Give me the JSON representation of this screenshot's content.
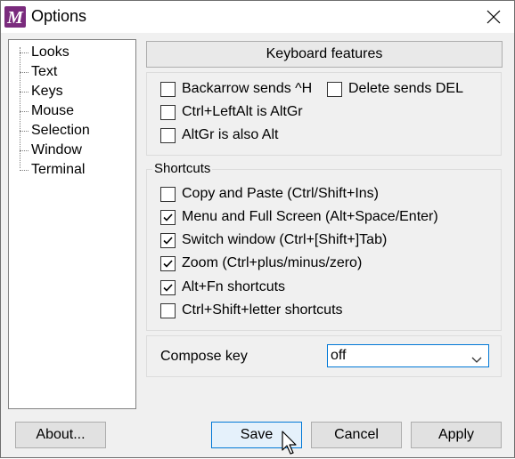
{
  "window": {
    "title": "Options"
  },
  "tree": {
    "items": [
      "Looks",
      "Text",
      "Keys",
      "Mouse",
      "Selection",
      "Window",
      "Terminal"
    ],
    "selected": "Keys"
  },
  "panel": {
    "header": "Keyboard features",
    "top_group": {
      "checkboxes": [
        {
          "label": "Backarrow sends ^H",
          "checked": false
        },
        {
          "label": "Delete sends DEL",
          "checked": false
        },
        {
          "label": "Ctrl+LeftAlt is AltGr",
          "checked": false
        },
        {
          "label": "AltGr is also Alt",
          "checked": false
        }
      ]
    },
    "shortcuts_group": {
      "title": "Shortcuts",
      "checkboxes": [
        {
          "label": "Copy and Paste (Ctrl/Shift+Ins)",
          "checked": false
        },
        {
          "label": "Menu and Full Screen (Alt+Space/Enter)",
          "checked": true
        },
        {
          "label": "Switch window (Ctrl+[Shift+]Tab)",
          "checked": true
        },
        {
          "label": "Zoom (Ctrl+plus/minus/zero)",
          "checked": true
        },
        {
          "label": "Alt+Fn shortcuts",
          "checked": true
        },
        {
          "label": "Ctrl+Shift+letter shortcuts",
          "checked": false
        }
      ]
    },
    "compose": {
      "label": "Compose key",
      "value": "off"
    }
  },
  "buttons": {
    "about": "About...",
    "save": "Save",
    "cancel": "Cancel",
    "apply": "Apply"
  },
  "colors": {
    "accent": "#0078d7",
    "app_icon": "#7a2b7d"
  },
  "icons": {
    "app": "mintty-icon",
    "close": "close-icon",
    "dropdown": "chevron-down-icon",
    "cursor": "mouse-pointer-icon"
  }
}
